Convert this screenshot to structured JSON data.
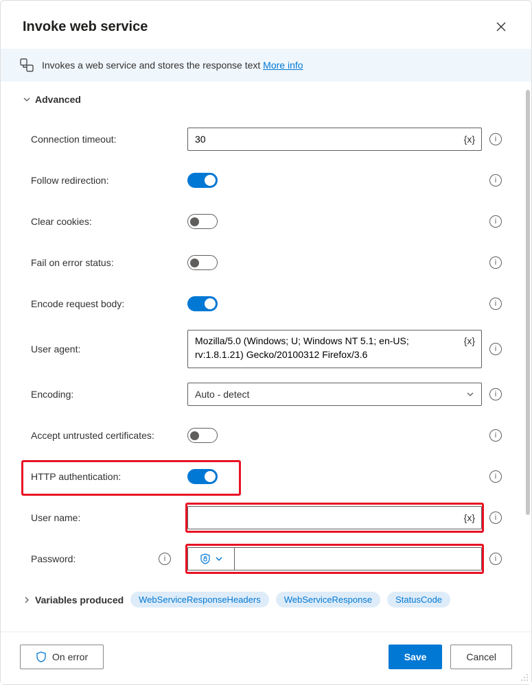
{
  "dialog": {
    "title": "Invoke web service",
    "info_text": "Invokes a web service and stores the response text ",
    "more_info": "More info"
  },
  "sections": {
    "advanced": "Advanced"
  },
  "fields": {
    "conn_timeout": {
      "label": "Connection timeout:",
      "value": "30"
    },
    "follow_redir": {
      "label": "Follow redirection:",
      "on": true
    },
    "clear_cookies": {
      "label": "Clear cookies:",
      "on": false
    },
    "fail_on_error": {
      "label": "Fail on error status:",
      "on": false
    },
    "encode_body": {
      "label": "Encode request body:",
      "on": true
    },
    "user_agent": {
      "label": "User agent:",
      "value": "Mozilla/5.0 (Windows; U; Windows NT 5.1; en-US; rv:1.8.1.21) Gecko/20100312 Firefox/3.6"
    },
    "encoding": {
      "label": "Encoding:",
      "value": "Auto - detect"
    },
    "accept_untrusted": {
      "label": "Accept untrusted certificates:",
      "on": false
    },
    "http_auth": {
      "label": "HTTP authentication:",
      "on": true
    },
    "user_name": {
      "label": "User name:",
      "value": ""
    },
    "password": {
      "label": "Password:",
      "value": ""
    }
  },
  "token_label": "{x}",
  "vars_produced": {
    "label": "Variables produced",
    "chips": [
      "WebServiceResponseHeaders",
      "WebServiceResponse",
      "StatusCode"
    ]
  },
  "footer": {
    "on_error": "On error",
    "save": "Save",
    "cancel": "Cancel"
  }
}
